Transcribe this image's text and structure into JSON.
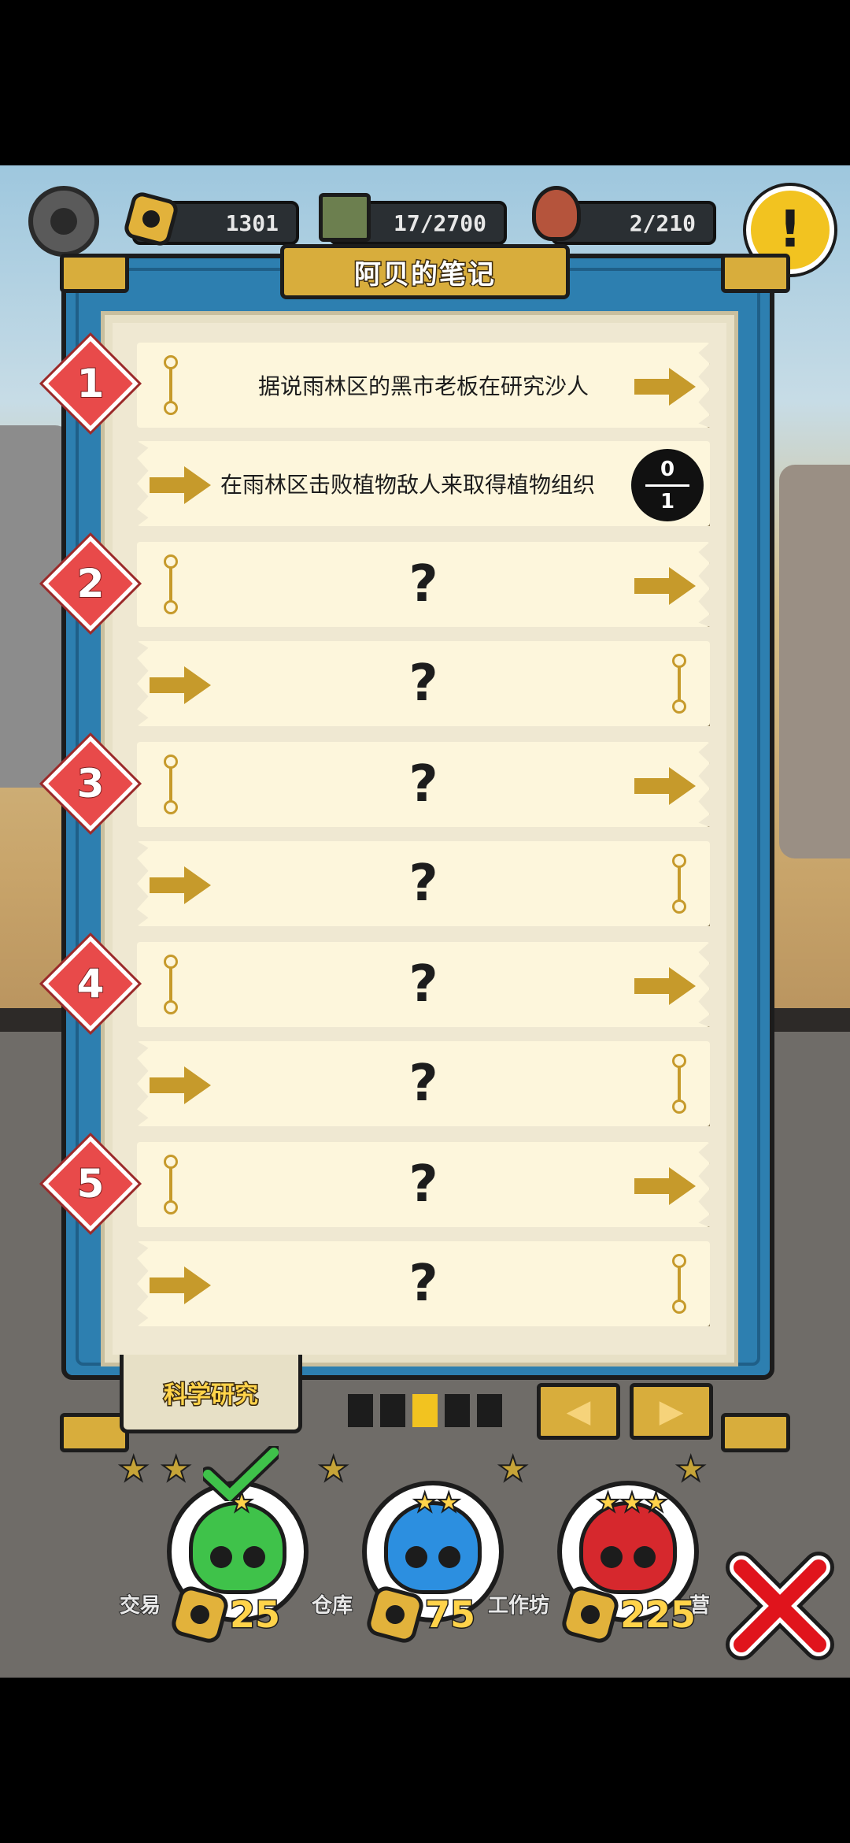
{
  "hud": {
    "bolts": "1301",
    "supplies": "17/2700",
    "food": "2/210",
    "alert": "!"
  },
  "notebook": {
    "title": "阿贝的笔记",
    "tab_label": "科学研究",
    "chapters": [
      "1",
      "2",
      "3",
      "4",
      "5"
    ],
    "rows": [
      {
        "text": "据说雨林区的黑市老板在研究沙人"
      },
      {
        "text": "在雨林区击败植物敌人来取得植物组织",
        "progress_current": "0",
        "progress_total": "1"
      },
      {
        "text": "?"
      },
      {
        "text": "?"
      },
      {
        "text": "?"
      },
      {
        "text": "?"
      },
      {
        "text": "?"
      },
      {
        "text": "?"
      },
      {
        "text": "?"
      },
      {
        "text": "?"
      }
    ],
    "page_indicator": {
      "pages": 5,
      "current": 3
    },
    "prev_icon": "◀",
    "next_icon": "▶"
  },
  "difficulty": [
    {
      "name": "easy",
      "stars": "★",
      "color": "#3fc24a",
      "cost": "25",
      "building": "交易",
      "completed": true
    },
    {
      "name": "normal",
      "stars": "★★",
      "color": "#2c8fe0",
      "cost": "75",
      "building": "仓库",
      "completed": false
    },
    {
      "name": "hard",
      "stars": "★★★",
      "color": "#d6282d",
      "cost": "225",
      "building": "工作坊",
      "completed": false
    }
  ],
  "barracks_label": "营",
  "colors": {
    "frame_blue": "#2d7fb0",
    "gold": "#d8ad3c",
    "badge_red": "#e84a4a",
    "close_red": "#e0141c"
  }
}
